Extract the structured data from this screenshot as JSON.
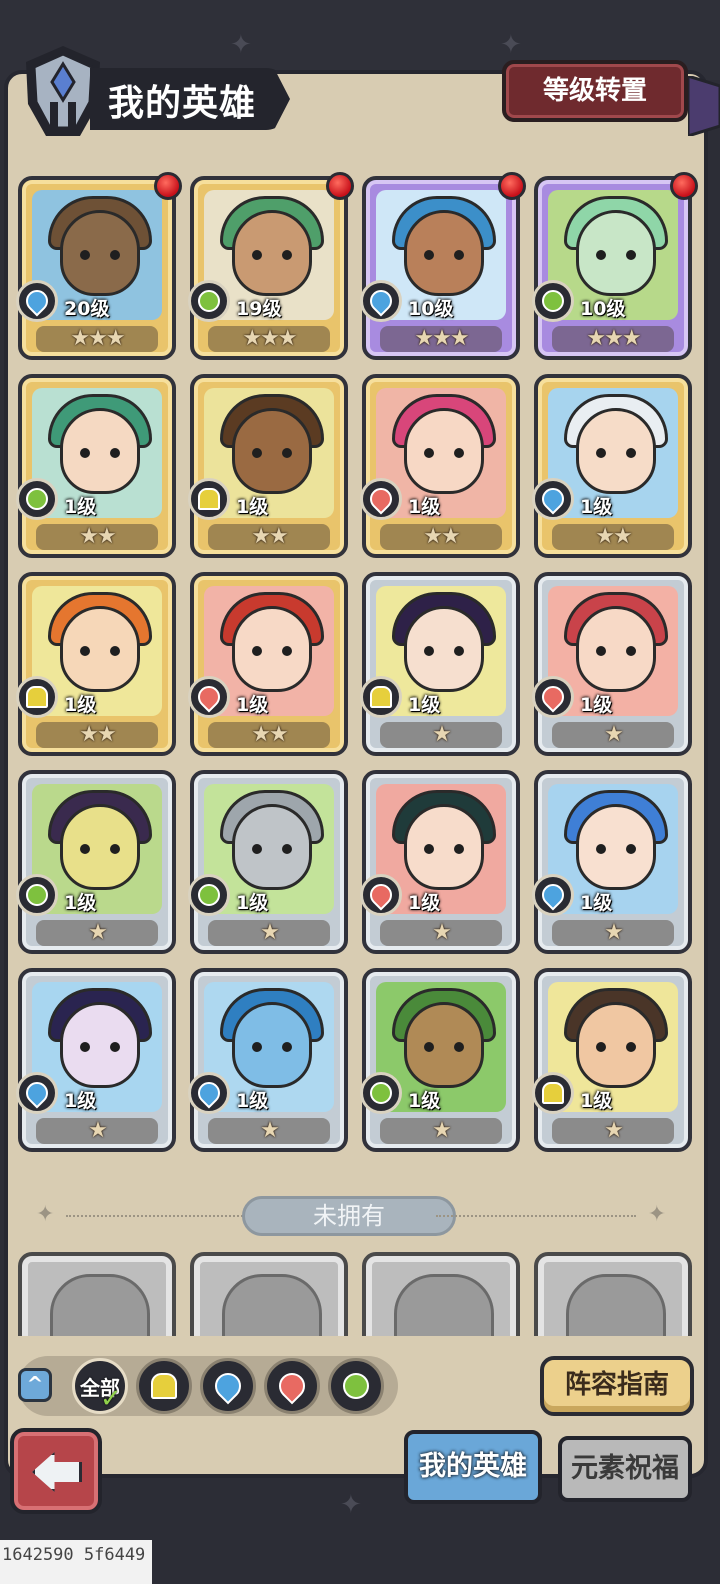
{
  "header": {
    "title": "我的英雄",
    "level_transfer_label": "等级转置"
  },
  "heroes": [
    {
      "level": "20级",
      "stars": "★★★",
      "element": "water",
      "frame": "gold",
      "new": true,
      "bg": "#8fc3e0",
      "skin": "#8a6a4a",
      "hair": "#6e5136"
    },
    {
      "level": "19级",
      "stars": "★★★",
      "element": "wind",
      "frame": "gold",
      "new": true,
      "bg": "#e9e1c8",
      "skin": "#c99a72",
      "hair": "#4f9f6a"
    },
    {
      "level": "10级",
      "stars": "★★★",
      "element": "water",
      "frame": "purple",
      "new": true,
      "bg": "#cfe7f7",
      "skin": "#b9805a",
      "hair": "#3c8fc9"
    },
    {
      "level": "10级",
      "stars": "★★★",
      "element": "wind",
      "frame": "purple",
      "new": true,
      "bg": "#b7d98a",
      "skin": "#c8e6c7",
      "hair": "#8fd6a8"
    },
    {
      "level": "1级",
      "stars": "★★",
      "element": "wind",
      "frame": "gold",
      "new": false,
      "bg": "#b9e0d2",
      "skin": "#f5d9c2",
      "hair": "#3f9a78"
    },
    {
      "level": "1级",
      "stars": "★★",
      "element": "earth",
      "frame": "gold",
      "new": false,
      "bg": "#ece39b",
      "skin": "#9a6a42",
      "hair": "#5b3b22"
    },
    {
      "level": "1级",
      "stars": "★★",
      "element": "fire",
      "frame": "gold",
      "new": false,
      "bg": "#f0b5a6",
      "skin": "#f7d8c5",
      "hair": "#d8467a"
    },
    {
      "level": "1级",
      "stars": "★★",
      "element": "water",
      "frame": "gold",
      "new": false,
      "bg": "#a7d4ee",
      "skin": "#f6dcc8",
      "hair": "#e9eef2"
    },
    {
      "level": "1级",
      "stars": "★★",
      "element": "earth",
      "frame": "gold",
      "new": false,
      "bg": "#efe79a",
      "skin": "#f6d7b8",
      "hair": "#e5762f"
    },
    {
      "level": "1级",
      "stars": "★★",
      "element": "fire",
      "frame": "gold",
      "new": false,
      "bg": "#f2b3a7",
      "skin": "#f7d9c6",
      "hair": "#c83a2e"
    },
    {
      "level": "1级",
      "stars": "★",
      "element": "earth",
      "frame": "silver",
      "new": false,
      "bg": "#eee89c",
      "skin": "#f6dfcf",
      "hair": "#2e2148"
    },
    {
      "level": "1级",
      "stars": "★",
      "element": "fire",
      "frame": "silver",
      "new": false,
      "bg": "#f3b1a5",
      "skin": "#f7d9c6",
      "hair": "#c9434a"
    },
    {
      "level": "1级",
      "stars": "★",
      "element": "wind",
      "frame": "silver",
      "new": false,
      "bg": "#bad98c",
      "skin": "#e8e08a",
      "hair": "#3a2a4e"
    },
    {
      "level": "1级",
      "stars": "★",
      "element": "wind",
      "frame": "silver",
      "new": false,
      "bg": "#c3e39a",
      "skin": "#bfc4c8",
      "hair": "#9ea6ac"
    },
    {
      "level": "1级",
      "stars": "★",
      "element": "fire",
      "frame": "silver",
      "new": false,
      "bg": "#f0a9a0",
      "skin": "#f7dccb",
      "hair": "#1f3b3a"
    },
    {
      "level": "1级",
      "stars": "★",
      "element": "water",
      "frame": "silver",
      "new": false,
      "bg": "#a7d3ef",
      "skin": "#f8e0d0",
      "hair": "#3f7fd6"
    },
    {
      "level": "1级",
      "stars": "★",
      "element": "water",
      "frame": "silver",
      "new": false,
      "bg": "#a8d6f0",
      "skin": "#eadcf0",
      "hair": "#2a2450"
    },
    {
      "level": "1级",
      "stars": "★",
      "element": "water",
      "frame": "silver",
      "new": false,
      "bg": "#aed8f0",
      "skin": "#7fbde6",
      "hair": "#2f7fc1"
    },
    {
      "level": "1级",
      "stars": "★",
      "element": "wind",
      "frame": "silver",
      "new": false,
      "bg": "#8cc96a",
      "skin": "#b08a56",
      "hair": "#4a8a3a"
    },
    {
      "level": "1级",
      "stars": "★",
      "element": "earth",
      "frame": "silver",
      "new": false,
      "bg": "#efe69a",
      "skin": "#f0c7a2",
      "hair": "#4a3528"
    }
  ],
  "unowned_label": "未拥有",
  "filter": {
    "all_label": "全部",
    "elements": [
      "earth",
      "water",
      "fire",
      "wind"
    ]
  },
  "guide_label": "阵容指南",
  "tabs": {
    "my_heroes": "我的英雄",
    "element_blessing": "元素祝福"
  },
  "debug_stamp": "1642590 5f6449",
  "colors": {
    "panel": "#d8ccb2",
    "gold_frame": "#e9c46b",
    "purple_frame": "#a88be0",
    "silver_frame": "#c3ccd4",
    "red_button": "#6f2a2e",
    "active_tab": "#6aa7d8"
  }
}
